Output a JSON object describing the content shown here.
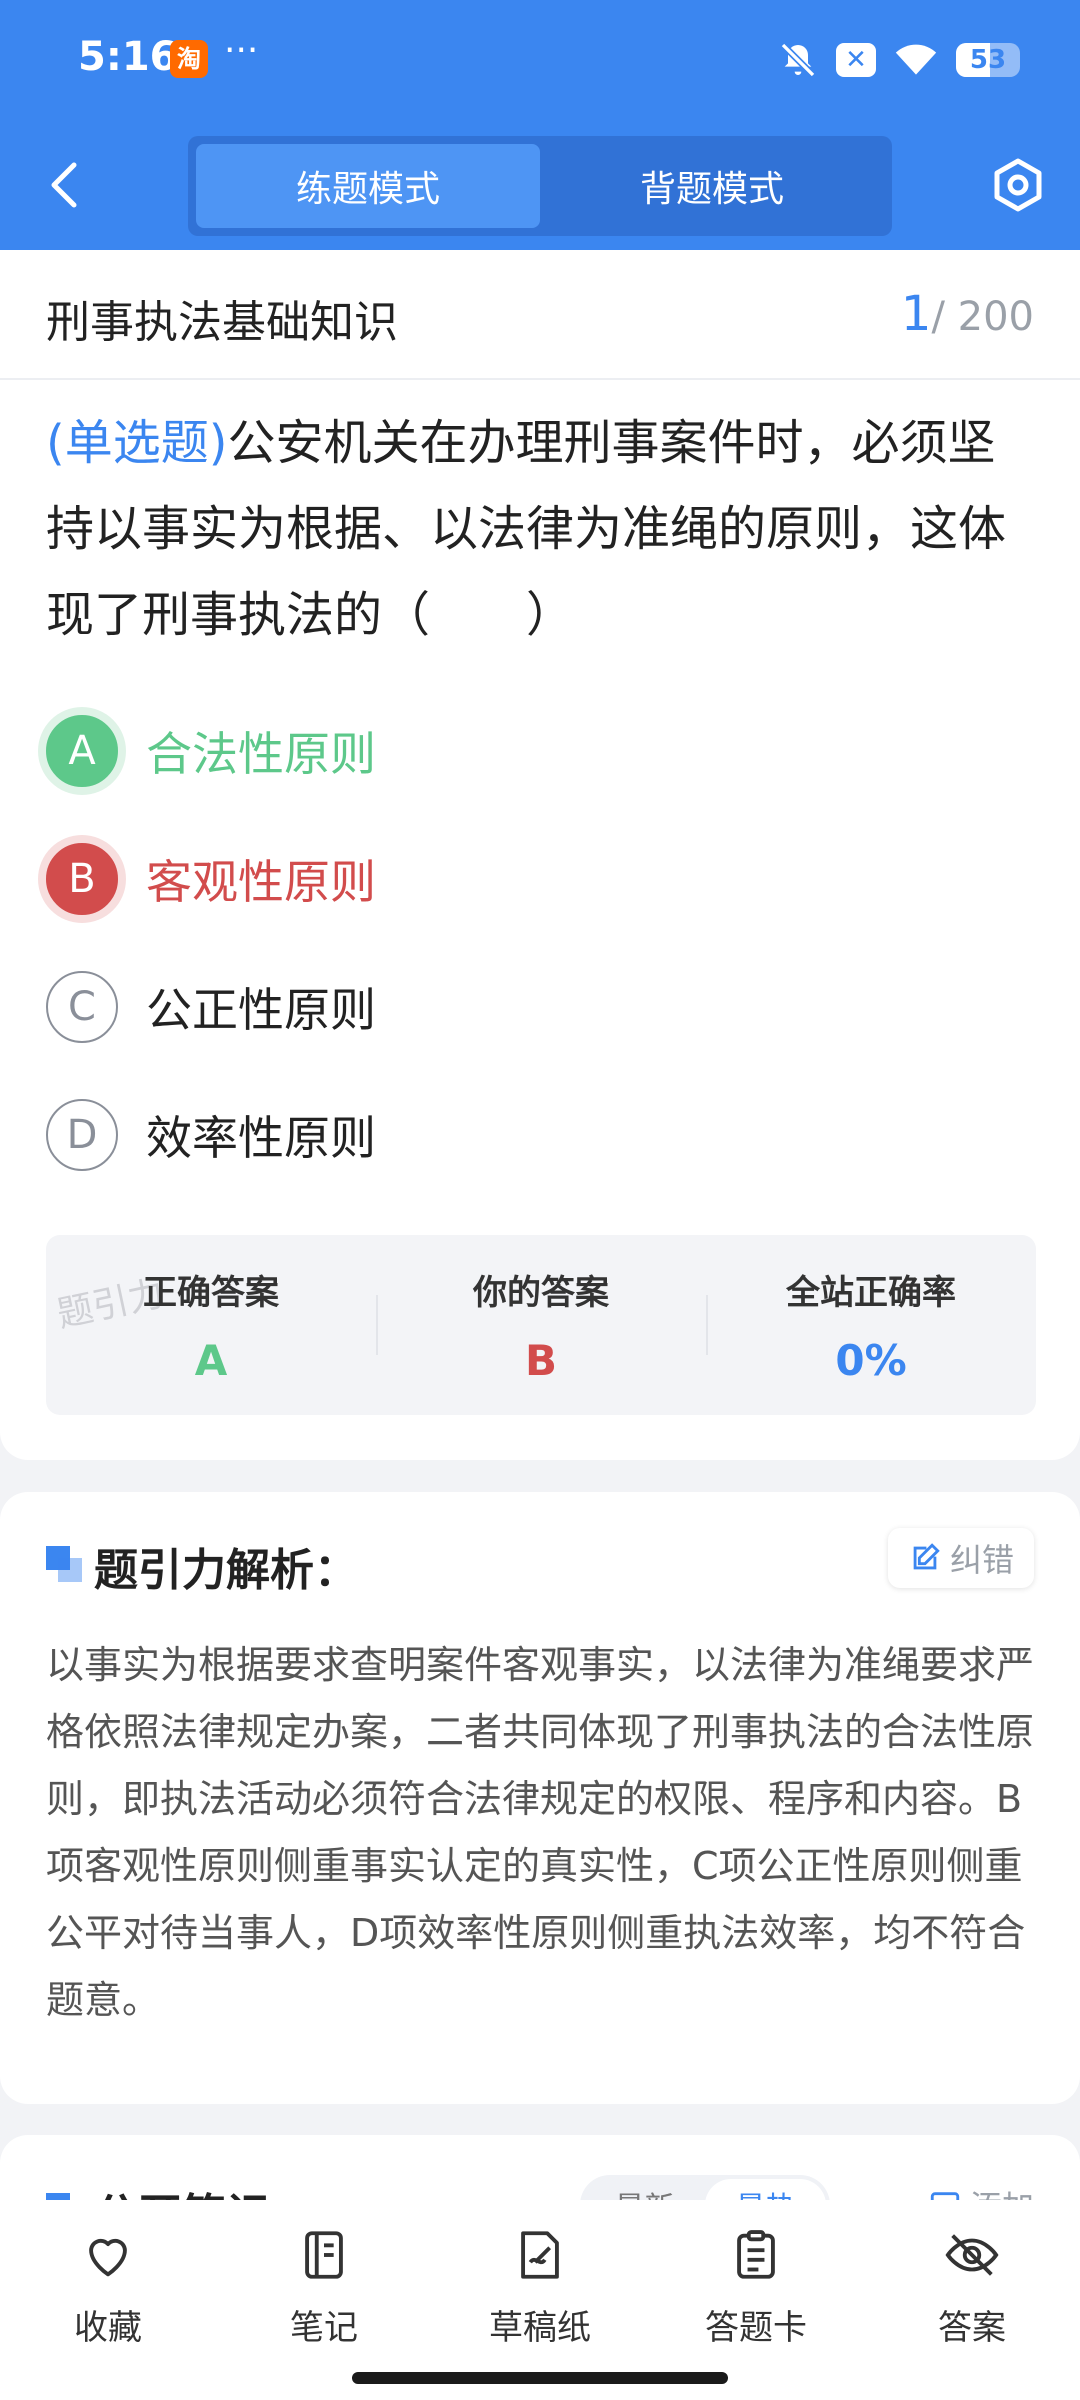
{
  "status_bar": {
    "time": "5:16",
    "app_badge": "淘",
    "battery": "53"
  },
  "header": {
    "tabs": [
      {
        "label": "练题模式",
        "active": true
      },
      {
        "label": "背题模式",
        "active": false
      }
    ]
  },
  "question": {
    "subject": "刑事执法基础知识",
    "current": "1",
    "total": "/ 200",
    "type": "(单选题)",
    "text": "公安机关在办理刑事案件时，必须坚持以事实为根据、以法律为准绳的原则，这体现了刑事执法的（　　）",
    "options": [
      {
        "letter": "A",
        "text": "合法性原则",
        "state": "correct"
      },
      {
        "letter": "B",
        "text": "客观性原则",
        "state": "wrong"
      },
      {
        "letter": "C",
        "text": "公正性原则",
        "state": "normal"
      },
      {
        "letter": "D",
        "text": "效率性原则",
        "state": "normal"
      }
    ]
  },
  "answer_summary": {
    "watermark": "题引力",
    "correct_label": "正确答案",
    "correct_value": "A",
    "yours_label": "你的答案",
    "yours_value": "B",
    "rate_label": "全站正确率",
    "rate_value": "0%"
  },
  "analysis": {
    "title": "题引力解析：",
    "report_label": "纠错",
    "text": "以事实为根据要求查明案件客观事实，以法律为准绳要求严格依照法律规定办案，二者共同体现了刑事执法的合法性原则，即执法活动必须符合法律规定的权限、程序和内容。B项客观性原则侧重事实认定的真实性，C项公正性原则侧重公平对待当事人，D项效率性原则侧重执法效率，均不符合题意。"
  },
  "notes": {
    "title": "公开笔记：",
    "sort_new": "最新",
    "sort_hot": "最热",
    "add_label": "添加"
  },
  "bottom_nav": [
    {
      "label": "收藏",
      "icon": "heart-icon"
    },
    {
      "label": "笔记",
      "icon": "notebook-icon"
    },
    {
      "label": "草稿纸",
      "icon": "draft-icon"
    },
    {
      "label": "答题卡",
      "icon": "clipboard-icon"
    },
    {
      "label": "答案",
      "icon": "eye-off-icon"
    }
  ],
  "colors": {
    "primary": "#3b86f0",
    "correct": "#5dc88a",
    "wrong": "#d24c4c"
  }
}
